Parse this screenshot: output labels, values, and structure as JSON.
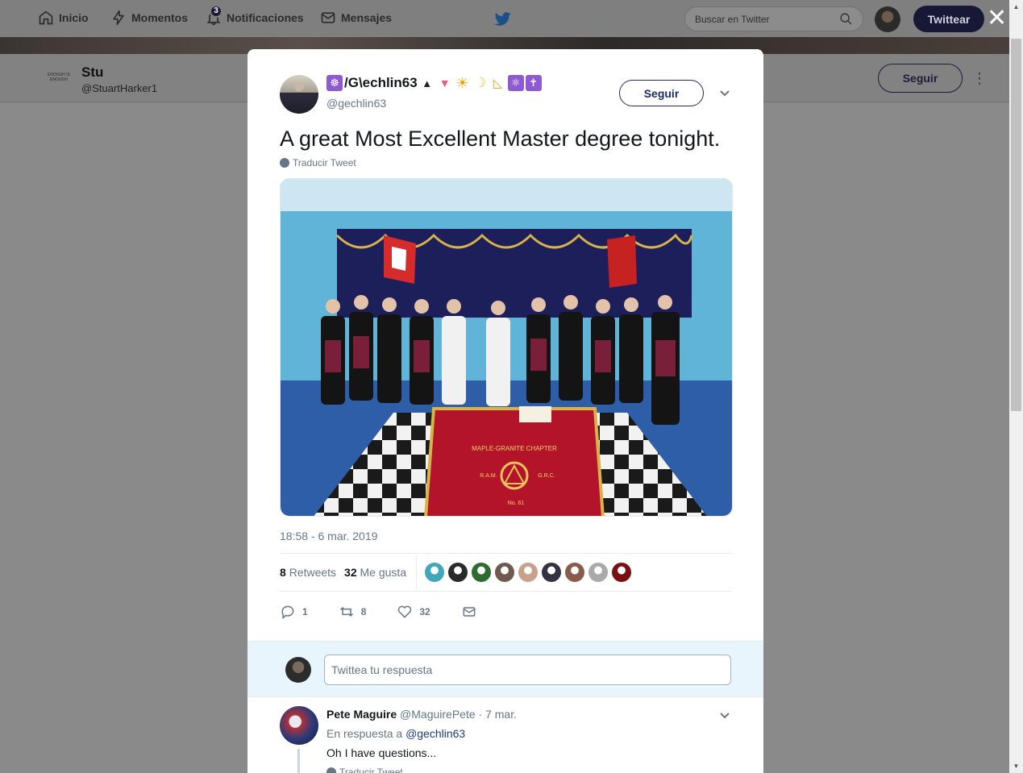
{
  "nav": {
    "home": "Inicio",
    "moments": "Momentos",
    "notifications": "Notificaciones",
    "notifications_count": "3",
    "messages": "Mensajes",
    "search_placeholder": "Buscar en Twitter",
    "tweet_button": "Twittear",
    "close": "✕"
  },
  "profile": {
    "logo_text": "ENOUGH IS ENOUGH",
    "name": "Stu",
    "handle": "@StuartHarker1",
    "follow": "Seguir",
    "more": "⋮"
  },
  "tweet": {
    "author_name": "/G\\echlin63",
    "author_handle": "@gechlin63",
    "emoji_before": "☸",
    "emojis_after": [
      "▲",
      "▼",
      "☀",
      "☽",
      "◺",
      "⚛",
      "✝"
    ],
    "follow": "Seguir",
    "text": "A great Most Excellent Master degree tonight.",
    "translate": "Traducir Tweet",
    "timestamp": "18:58 - 6 mar. 2019",
    "retweets_count": "8",
    "retweets_label": "Retweets",
    "likes_count": "32",
    "likes_label": "Me gusta",
    "liker_avatar_colors": [
      "#3fa8b8",
      "#2a2a2a",
      "#2e6b2e",
      "#6d5b52",
      "#c7a18a",
      "#333344",
      "#8a5a4a",
      "#aaaaaa",
      "#7a1010"
    ],
    "actions": {
      "reply_count": "1",
      "retweet_count": "8",
      "like_count": "32"
    },
    "photo": {
      "banner_line1": "MAPLE-GRANITE CHAPTER",
      "banner_left": "R.A.M.",
      "banner_right": "G.R.C.",
      "banner_bottom": "No. 61"
    }
  },
  "reply_box": {
    "placeholder": "Twittea tu respuesta"
  },
  "reply": {
    "name": "Pete Maguire",
    "handle": "@MaguirePete",
    "date": "· 7 mar.",
    "in_reply_to_prefix": "En respuesta a",
    "in_reply_to_handle": "@gechlin63",
    "text": "Oh I have questions...",
    "translate": "Traducir Tweet"
  }
}
